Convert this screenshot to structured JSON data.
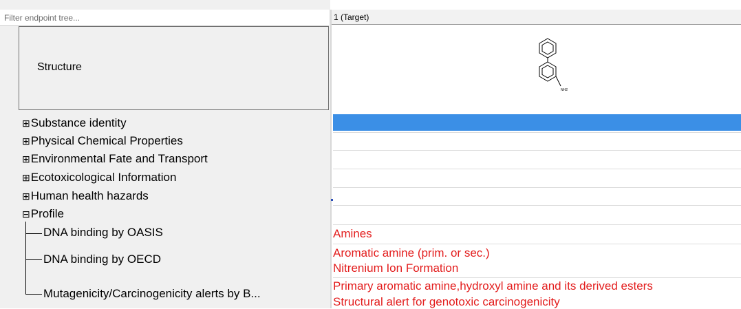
{
  "filter": {
    "placeholder": "Filter endpoint tree..."
  },
  "structure": {
    "label": "Structure",
    "molecule_sub_label": "NH2"
  },
  "column": {
    "header": "1 (Target)"
  },
  "tree": {
    "expand_symbol": "⊞",
    "collapse_symbol": "⊟",
    "nodes": [
      {
        "label": "Substance identity",
        "expanded": false
      },
      {
        "label": "Physical Chemical Properties",
        "expanded": false
      },
      {
        "label": "Environmental Fate and Transport",
        "expanded": false
      },
      {
        "label": "Ecotoxicological Information",
        "expanded": false
      },
      {
        "label": "Human health hazards",
        "expanded": false
      },
      {
        "label": "Profile",
        "expanded": true
      }
    ],
    "profile_children": [
      {
        "label": "DNA binding by OASIS"
      },
      {
        "label": "DNA binding by OECD"
      },
      {
        "label": "Mutagenicity/Carcinogenicity alerts by B..."
      }
    ]
  },
  "results": {
    "dna_oasis": [
      "Amines"
    ],
    "dna_oecd": [
      "Aromatic amine (prim. or sec.)",
      "Nitrenium Ion Formation"
    ],
    "mutagenicity": [
      "Primary aromatic amine,hydroxyl amine and its derived esters",
      "Structural alert for genotoxic carcinogenicity"
    ]
  },
  "colors": {
    "selection": "#3b8fe6",
    "result_text": "#e31d1d",
    "pane_background": "#f0f0f0"
  }
}
